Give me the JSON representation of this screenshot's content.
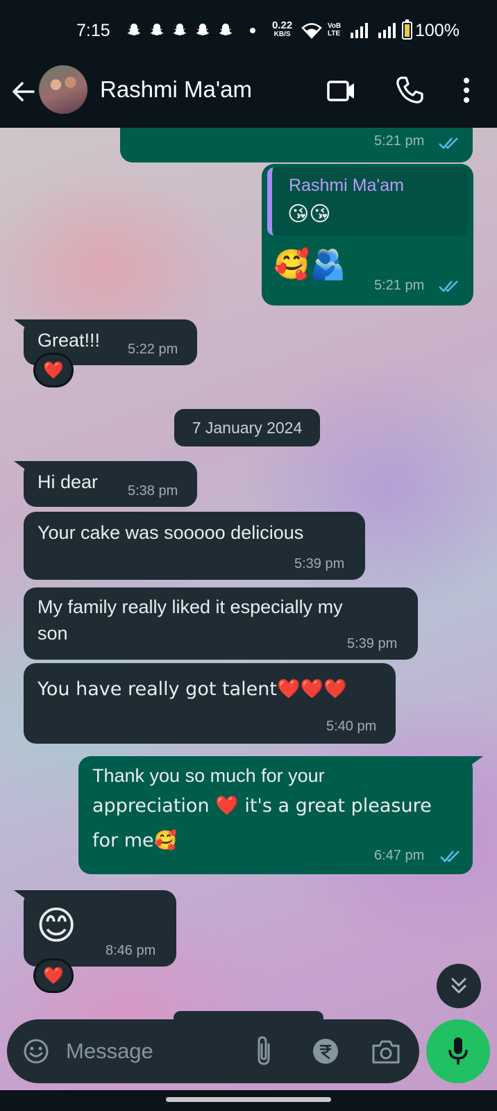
{
  "status_bar": {
    "time": "7:15",
    "net_speed_value": "0.22",
    "net_speed_unit": "KB/S",
    "volte_line1": "VoB",
    "volte_line2": "LTE",
    "battery_percent": "100%",
    "battery_level": 1.0
  },
  "header": {
    "contact_name": "Rashmi Ma'am"
  },
  "messages": [
    {
      "direction": "out",
      "text": "",
      "time": "5:21 pm",
      "status": "read"
    },
    {
      "direction": "out",
      "reply_to": {
        "name": "Rashmi Ma'am",
        "text": "😘😘"
      },
      "text": "🥰🫂",
      "time": "5:21 pm",
      "status": "read"
    },
    {
      "direction": "in",
      "text": "Great!!!",
      "time": "5:22 pm",
      "reaction": "❤️"
    },
    {
      "direction": "in",
      "text": "Hi dear",
      "time": "5:38 pm"
    },
    {
      "direction": "in",
      "text": "Your cake was sooooo delicious",
      "time": "5:39 pm"
    },
    {
      "direction": "in",
      "text_lines": [
        "My family really liked it especially my",
        "son"
      ],
      "time": "5:39 pm"
    },
    {
      "direction": "in",
      "text": "You have really got talent❤️❤️❤️",
      "time": "5:40 pm"
    },
    {
      "direction": "out",
      "text_lines": [
        "Thank you so much for your",
        "appreciation ❤️ it's a great pleasure",
        "for me🥰"
      ],
      "time": "6:47 pm",
      "status": "read"
    },
    {
      "direction": "in",
      "text": "😊",
      "time": "8:46 pm",
      "reaction": "❤️"
    }
  ],
  "date_separator": "7 January 2024",
  "input": {
    "placeholder": "Message"
  },
  "colors": {
    "incoming_bubble": "#202c33",
    "outgoing_bubble": "#005c4b",
    "mic_button": "#21c063",
    "read_ticks": "#53bdeb",
    "quote_accent": "#a78bfa"
  },
  "icons": [
    "back-arrow-icon",
    "video-call-icon",
    "phone-icon",
    "more-vertical-icon",
    "emoji-icon",
    "attach-icon",
    "rupee-icon",
    "camera-icon",
    "mic-icon",
    "chevron-double-down-icon"
  ]
}
